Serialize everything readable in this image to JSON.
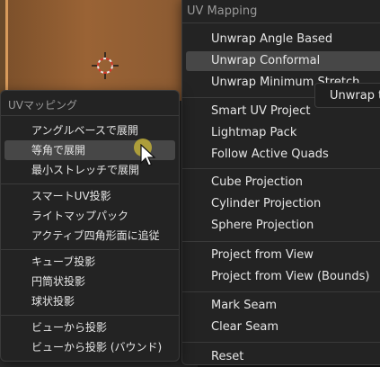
{
  "viewport": {
    "cursor_icon": "3d-cursor-icon"
  },
  "menu_en": {
    "title": "UV Mapping",
    "items": [
      {
        "label": "Unwrap Angle Based"
      },
      {
        "label": "Unwrap Conformal"
      },
      {
        "label": "Unwrap Minimum Stretch"
      },
      {
        "label": "Smart UV Project"
      },
      {
        "label": "Lightmap Pack"
      },
      {
        "label": "Follow Active Quads"
      },
      {
        "label": "Cube Projection"
      },
      {
        "label": "Cylinder Projection"
      },
      {
        "label": "Sphere Projection"
      },
      {
        "label": "Project from View"
      },
      {
        "label": "Project from View (Bounds)"
      },
      {
        "label": "Mark Seam"
      },
      {
        "label": "Clear Seam"
      },
      {
        "label": "Reset"
      }
    ]
  },
  "menu_ja": {
    "title": "UVマッピング",
    "items": [
      {
        "label": "アングルベースで展開"
      },
      {
        "label": "等角で展開"
      },
      {
        "label": "最小ストレッチで展開"
      },
      {
        "label": "スマートUV投影"
      },
      {
        "label": "ライトマップパック"
      },
      {
        "label": "アクティブ四角形面に追従"
      },
      {
        "label": "キューブ投影"
      },
      {
        "label": "円筒状投影"
      },
      {
        "label": "球状投影"
      },
      {
        "label": "ビューから投影"
      },
      {
        "label": "ビューから投影 (バウンド)"
      }
    ]
  },
  "tooltip": {
    "text": "Unwrap t"
  }
}
